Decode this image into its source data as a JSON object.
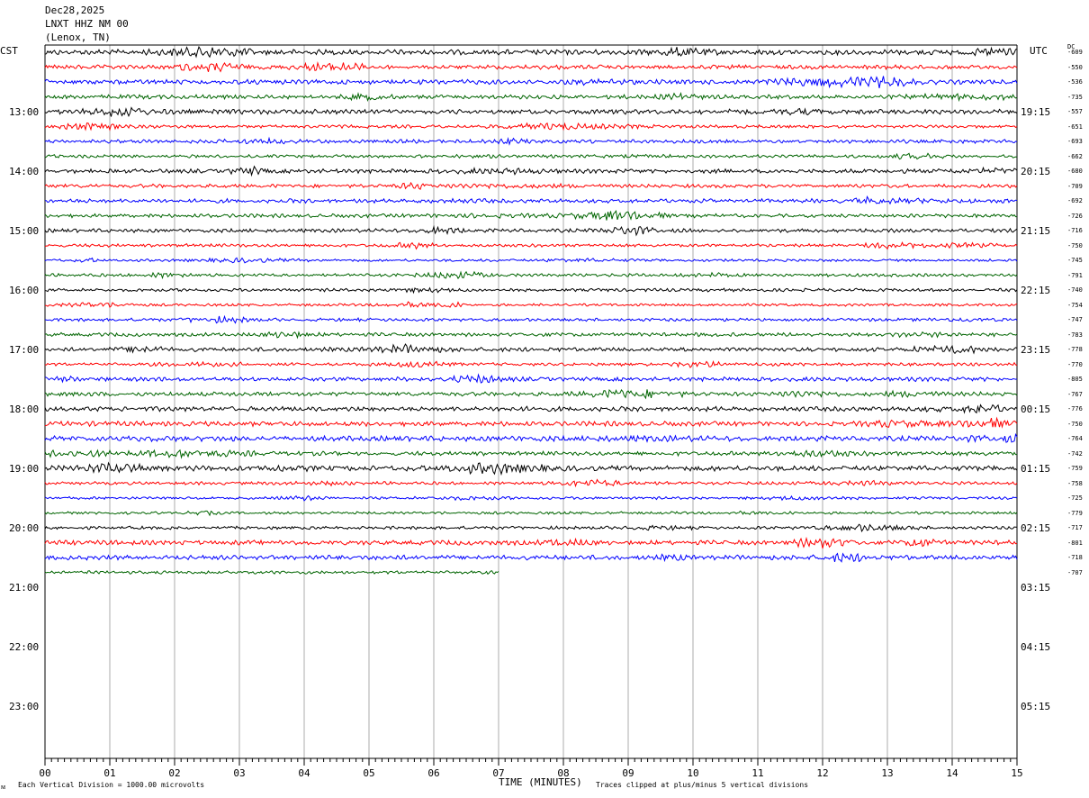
{
  "header": {
    "date": "Dec28,2025",
    "station": "LNXT HHZ NM 00",
    "location": "(Lenox, TN)"
  },
  "left_axis_label": "CST",
  "right_axis_label": "UTC",
  "dc_label": "DC",
  "footer": {
    "vertical_division": "Each Vertical Division = 1000.00 microvolts",
    "clip_note": "Traces clipped at plus/minus 5 vertical divisions",
    "corner_mark": "ᴍ"
  },
  "chart_data": {
    "type": "line",
    "title": "",
    "xlabel": "TIME (MINUTES)",
    "xlim": [
      0,
      15
    ],
    "x_tick_labels": [
      "00",
      "01",
      "02",
      "03",
      "04",
      "05",
      "06",
      "07",
      "08",
      "09",
      "10",
      "11",
      "12",
      "13",
      "14",
      "15"
    ],
    "cst_hour_labels": [
      "13:00",
      "14:00",
      "15:00",
      "16:00",
      "17:00",
      "18:00",
      "19:00",
      "20:00",
      "21:00",
      "22:00",
      "23:00"
    ],
    "utc_hour_labels": [
      "19:15",
      "20:15",
      "21:15",
      "22:15",
      "23:15",
      "00:15",
      "01:15",
      "02:15",
      "03:15",
      "04:15",
      "05:15"
    ],
    "trace_colors": [
      "#000000",
      "#ff0000",
      "#0000ff",
      "#006400"
    ],
    "traces": [
      {
        "dc": "-609",
        "minutes": 15,
        "amplitude": 1.0
      },
      {
        "dc": "-550",
        "minutes": 15,
        "amplitude": 0.8
      },
      {
        "dc": "-536",
        "minutes": 15,
        "amplitude": 0.9
      },
      {
        "dc": "-735",
        "minutes": 15,
        "amplitude": 0.8
      },
      {
        "dc": "-557",
        "minutes": 15,
        "amplitude": 0.9
      },
      {
        "dc": "-651",
        "minutes": 15,
        "amplitude": 0.6
      },
      {
        "dc": "-693",
        "minutes": 15,
        "amplitude": 0.7
      },
      {
        "dc": "-662",
        "minutes": 15,
        "amplitude": 0.6
      },
      {
        "dc": "-680",
        "minutes": 15,
        "amplitude": 0.8
      },
      {
        "dc": "-709",
        "minutes": 15,
        "amplitude": 0.7
      },
      {
        "dc": "-692",
        "minutes": 15,
        "amplitude": 0.8
      },
      {
        "dc": "-726",
        "minutes": 15,
        "amplitude": 0.7
      },
      {
        "dc": "-716",
        "minutes": 15,
        "amplitude": 0.7
      },
      {
        "dc": "-750",
        "minutes": 15,
        "amplitude": 0.6
      },
      {
        "dc": "-745",
        "minutes": 15,
        "amplitude": 0.5
      },
      {
        "dc": "-791",
        "minutes": 15,
        "amplitude": 0.6
      },
      {
        "dc": "-740",
        "minutes": 15,
        "amplitude": 0.6
      },
      {
        "dc": "-754",
        "minutes": 15,
        "amplitude": 0.5
      },
      {
        "dc": "-747",
        "minutes": 15,
        "amplitude": 0.6
      },
      {
        "dc": "-783",
        "minutes": 15,
        "amplitude": 0.7
      },
      {
        "dc": "-778",
        "minutes": 15,
        "amplitude": 0.8
      },
      {
        "dc": "-770",
        "minutes": 15,
        "amplitude": 0.6
      },
      {
        "dc": "-805",
        "minutes": 15,
        "amplitude": 0.8
      },
      {
        "dc": "-767",
        "minutes": 15,
        "amplitude": 0.8
      },
      {
        "dc": "-776",
        "minutes": 15,
        "amplitude": 0.9
      },
      {
        "dc": "-750",
        "minutes": 15,
        "amplitude": 0.9
      },
      {
        "dc": "-764",
        "minutes": 15,
        "amplitude": 1.0
      },
      {
        "dc": "-742",
        "minutes": 15,
        "amplitude": 0.8
      },
      {
        "dc": "-759",
        "minutes": 15,
        "amplitude": 1.0
      },
      {
        "dc": "-758",
        "minutes": 15,
        "amplitude": 0.6
      },
      {
        "dc": "-725",
        "minutes": 15,
        "amplitude": 0.5
      },
      {
        "dc": "-779",
        "minutes": 15,
        "amplitude": 0.5
      },
      {
        "dc": "-717",
        "minutes": 15,
        "amplitude": 0.6
      },
      {
        "dc": "-801",
        "minutes": 15,
        "amplitude": 0.9
      },
      {
        "dc": "-718",
        "minutes": 15,
        "amplitude": 0.9
      },
      {
        "dc": "-707",
        "minutes": 7,
        "amplitude": 0.6
      }
    ]
  }
}
